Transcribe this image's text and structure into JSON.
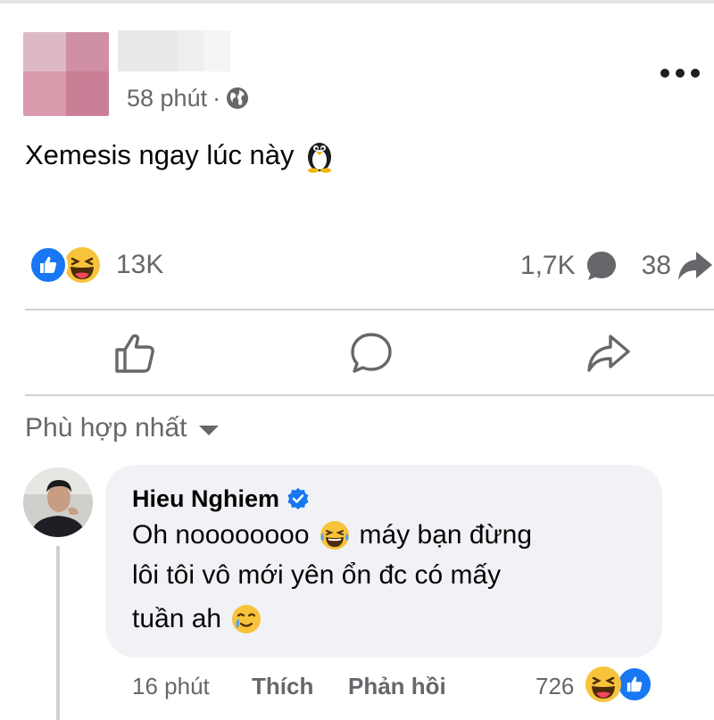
{
  "post": {
    "time": "58 phút",
    "separator": "·",
    "text": "Xemesis ngay lúc này",
    "reaction_count": "13K",
    "comment_count": "1,7K",
    "share_count": "38"
  },
  "sort": {
    "label": "Phù hợp nhất"
  },
  "comment": {
    "author": "Hieu Nghiem",
    "line1_a": "Oh noooooooo",
    "line1_b": "máy bạn đừng",
    "line2": "lôi tôi vô mới yên ổn đc có mấy",
    "line3": "tuần ah",
    "time": "16 phút",
    "like_label": "Thích",
    "reply_label": "Phản hồi",
    "reaction_count": "726"
  },
  "icons": {
    "privacy": "globe-icon",
    "post_emoji": "penguin-icon",
    "more": "more-icon",
    "like": "like-icon",
    "haha": "haha-icon",
    "comment": "comment-bubble-icon",
    "share": "share-arrow-icon",
    "verified": "verified-icon"
  },
  "colors": {
    "brand_blue": "#1877f2",
    "secondary_text": "#65676b",
    "bubble_bg": "#f0f2f5",
    "divider": "#ced0d4"
  }
}
